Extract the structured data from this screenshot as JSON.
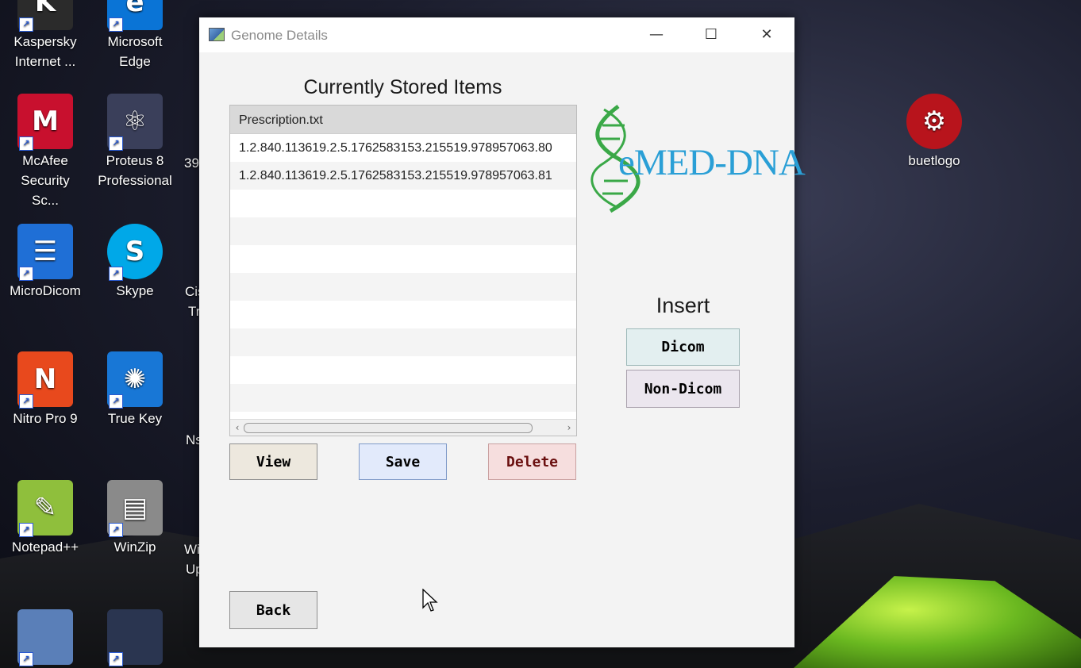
{
  "desktop": {
    "icons": [
      {
        "label": "Kaspersky Internet ...",
        "glyph": "K",
        "color": "#2b2b2b"
      },
      {
        "label": "Microsoft Edge",
        "glyph": "e",
        "color": "#0a74d6"
      },
      {
        "label": "McAfee Security Sc...",
        "glyph": "M",
        "color": "#c8102e"
      },
      {
        "label": "Proteus 8 Professional",
        "glyph": "⚛",
        "color": "#3a3f5a"
      },
      {
        "label": "MicroDicom",
        "glyph": "☰",
        "color": "#1f6fd6"
      },
      {
        "label": "Skype",
        "glyph": "S",
        "color": "#00a8e8"
      },
      {
        "label": "Nitro Pro 9",
        "glyph": "N",
        "color": "#e8491d"
      },
      {
        "label": "True Key",
        "glyph": "✺",
        "color": "#1877d6"
      },
      {
        "label": "Notepad++",
        "glyph": "✎",
        "color": "#8fbf3c"
      },
      {
        "label": "WinZip",
        "glyph": "▤",
        "color": "#8a8a8a"
      },
      {
        "label": "buetlogo",
        "glyph": "⚙",
        "color": "#b8141c"
      }
    ],
    "partial_labels": [
      "39",
      "Cis",
      "Tr",
      "Ns",
      "Wi",
      "Up"
    ]
  },
  "window": {
    "title": "Genome Details",
    "controls": {
      "minimize": "—",
      "maximize": "☐",
      "close": "✕"
    },
    "heading": "Currently Stored Items",
    "list": {
      "header": "Prescription.txt",
      "rows": [
        "1.2.840.113619.2.5.1762583153.215519.978957063.80",
        "1.2.840.113619.2.5.1762583153.215519.978957063.81"
      ]
    },
    "buttons": {
      "view": "View",
      "save": "Save",
      "delete": "Delete",
      "back": "Back"
    },
    "logo": {
      "text": "eMED-DNA",
      "text_color": "#2a9fd6",
      "helix_color": "#3aa847"
    },
    "insert": {
      "label": "Insert",
      "dicom": "Dicom",
      "non_dicom": "Non-Dicom"
    }
  }
}
